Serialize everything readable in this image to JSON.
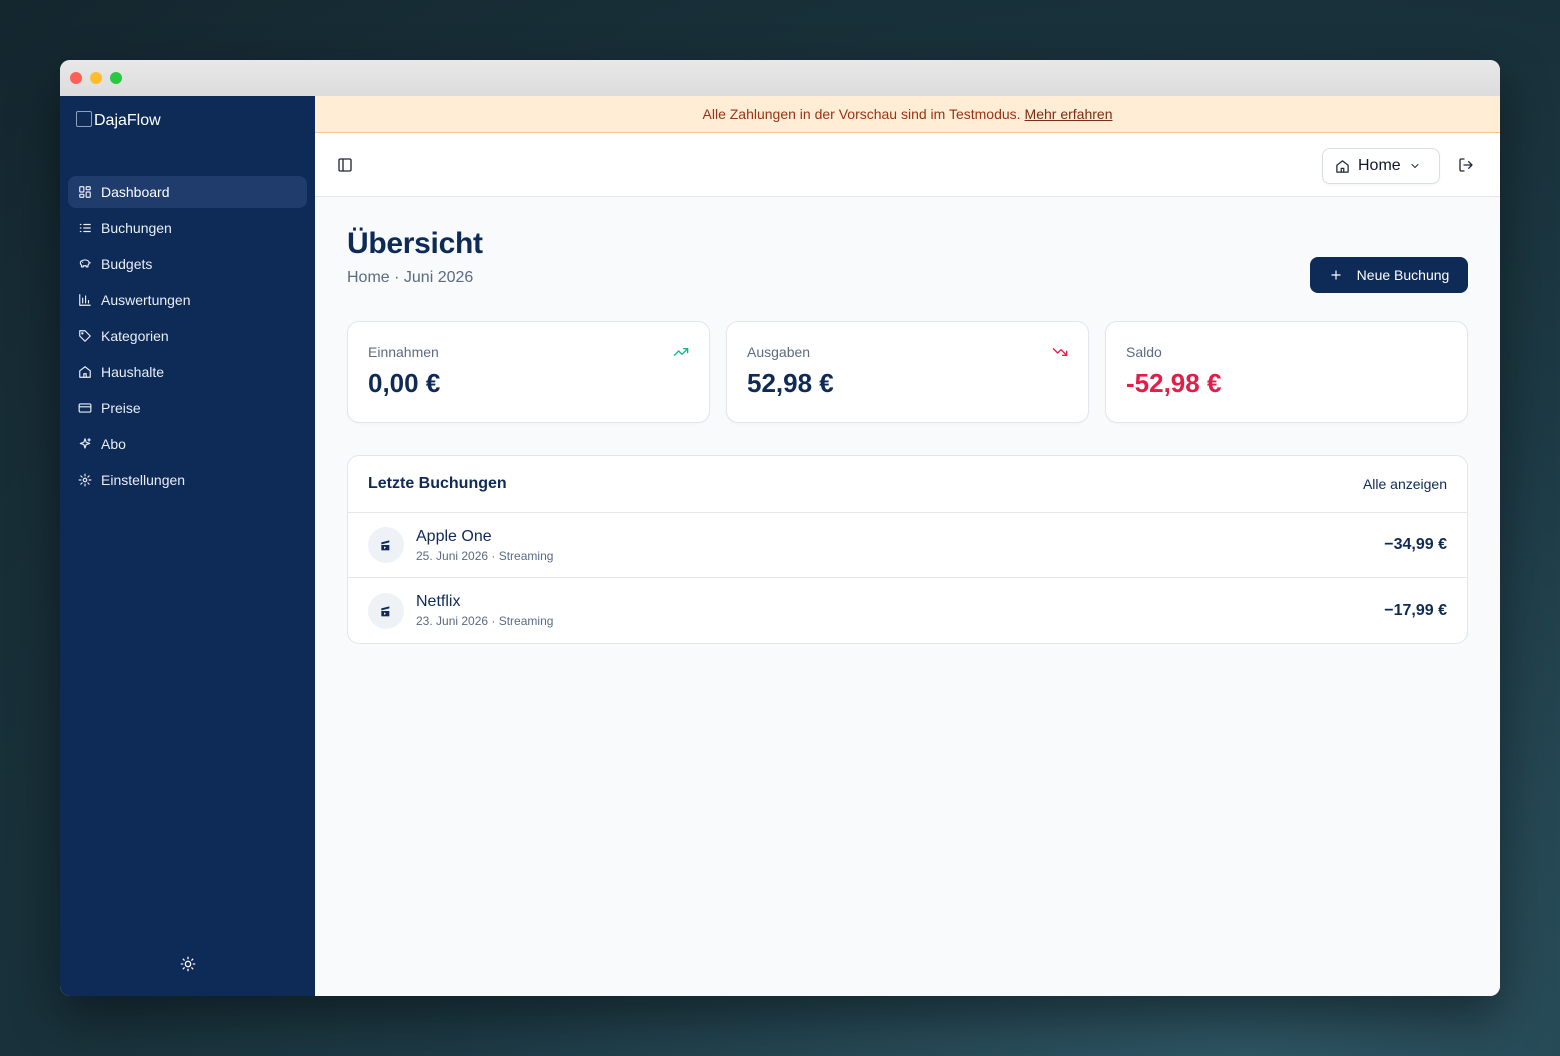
{
  "app": {
    "logo_alt": "DajaFlow"
  },
  "sidebar": {
    "items": [
      {
        "label": "Dashboard",
        "icon": "dashboard-icon",
        "active": true
      },
      {
        "label": "Buchungen",
        "icon": "list-icon"
      },
      {
        "label": "Budgets",
        "icon": "piggy-bank-icon"
      },
      {
        "label": "Auswertungen",
        "icon": "bar-chart-icon"
      },
      {
        "label": "Kategorien",
        "icon": "tag-icon"
      },
      {
        "label": "Haushalte",
        "icon": "home-icon"
      },
      {
        "label": "Preise",
        "icon": "credit-card-icon"
      },
      {
        "label": "Abo",
        "icon": "sparkles-icon"
      },
      {
        "label": "Einstellungen",
        "icon": "gear-icon"
      }
    ],
    "theme_icon": "sun-icon"
  },
  "banner": {
    "text": "Alle Zahlungen in der Vorschau sind im Testmodus.",
    "link": "Mehr erfahren"
  },
  "topbar": {
    "household": "Home"
  },
  "page": {
    "title": "Übersicht",
    "subtitle": "Home · Juni 2026",
    "new_button": "Neue Buchung"
  },
  "stats": [
    {
      "label": "Einnahmen",
      "value": "0,00 €",
      "trend": "up",
      "color": "#10b981"
    },
    {
      "label": "Ausgaben",
      "value": "52,98 €",
      "trend": "down",
      "color": "#e11d48"
    },
    {
      "label": "Saldo",
      "value": "-52,98 €",
      "negative": true,
      "color": "#e11d48"
    }
  ],
  "recent": {
    "title": "Letzte Buchungen",
    "link": "Alle anzeigen",
    "rows": [
      {
        "title": "Apple One",
        "meta": "25. Juni 2026 · Streaming",
        "amount": "−34,99 €"
      },
      {
        "title": "Netflix",
        "meta": "23. Juni 2026 · Streaming",
        "amount": "−17,99 €"
      }
    ]
  },
  "colors": {
    "primary": "#0e2a56",
    "negative": "#e11d48",
    "positive": "#10b981",
    "banner_bg": "#ffedd5"
  }
}
